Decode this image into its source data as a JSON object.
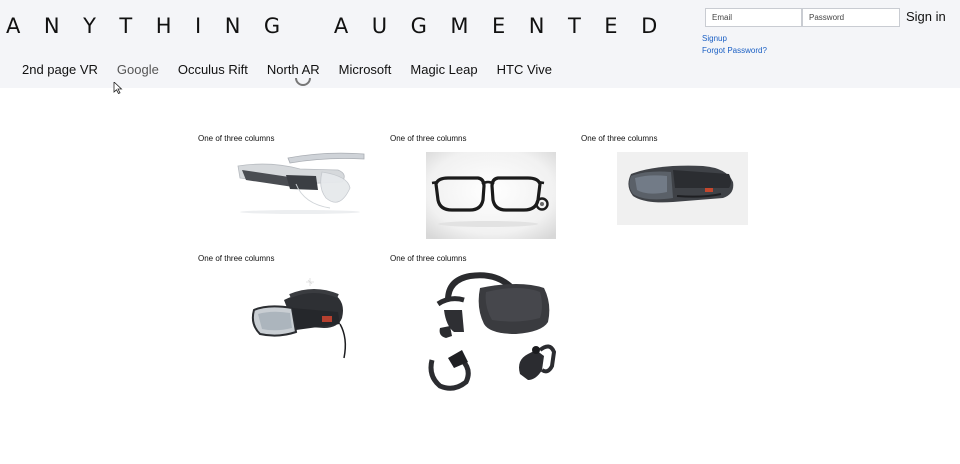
{
  "header": {
    "brand": "ANYTHING AUGMENTED"
  },
  "nav": {
    "items": [
      "2nd page VR",
      "Google",
      "Occulus Rift",
      "North AR",
      "Microsoft",
      "Magic Leap",
      "HTC Vive"
    ]
  },
  "auth": {
    "email_placeholder": "Email",
    "password_placeholder": "Password",
    "signin_label": "Sign in",
    "signup_label": "Signup",
    "forgot_label": "Forgot Password?"
  },
  "grid": {
    "columns": [
      {
        "label": "One of three columns",
        "image": "google-glass-image"
      },
      {
        "label": "One of three columns",
        "image": "north-focals-glasses-image"
      },
      {
        "label": "One of three columns",
        "image": "hololens-image"
      },
      {
        "label": "One of three columns",
        "image": "magic-leap-headset-image"
      },
      {
        "label": "One of three columns",
        "image": "oculus-rift-image"
      }
    ]
  }
}
